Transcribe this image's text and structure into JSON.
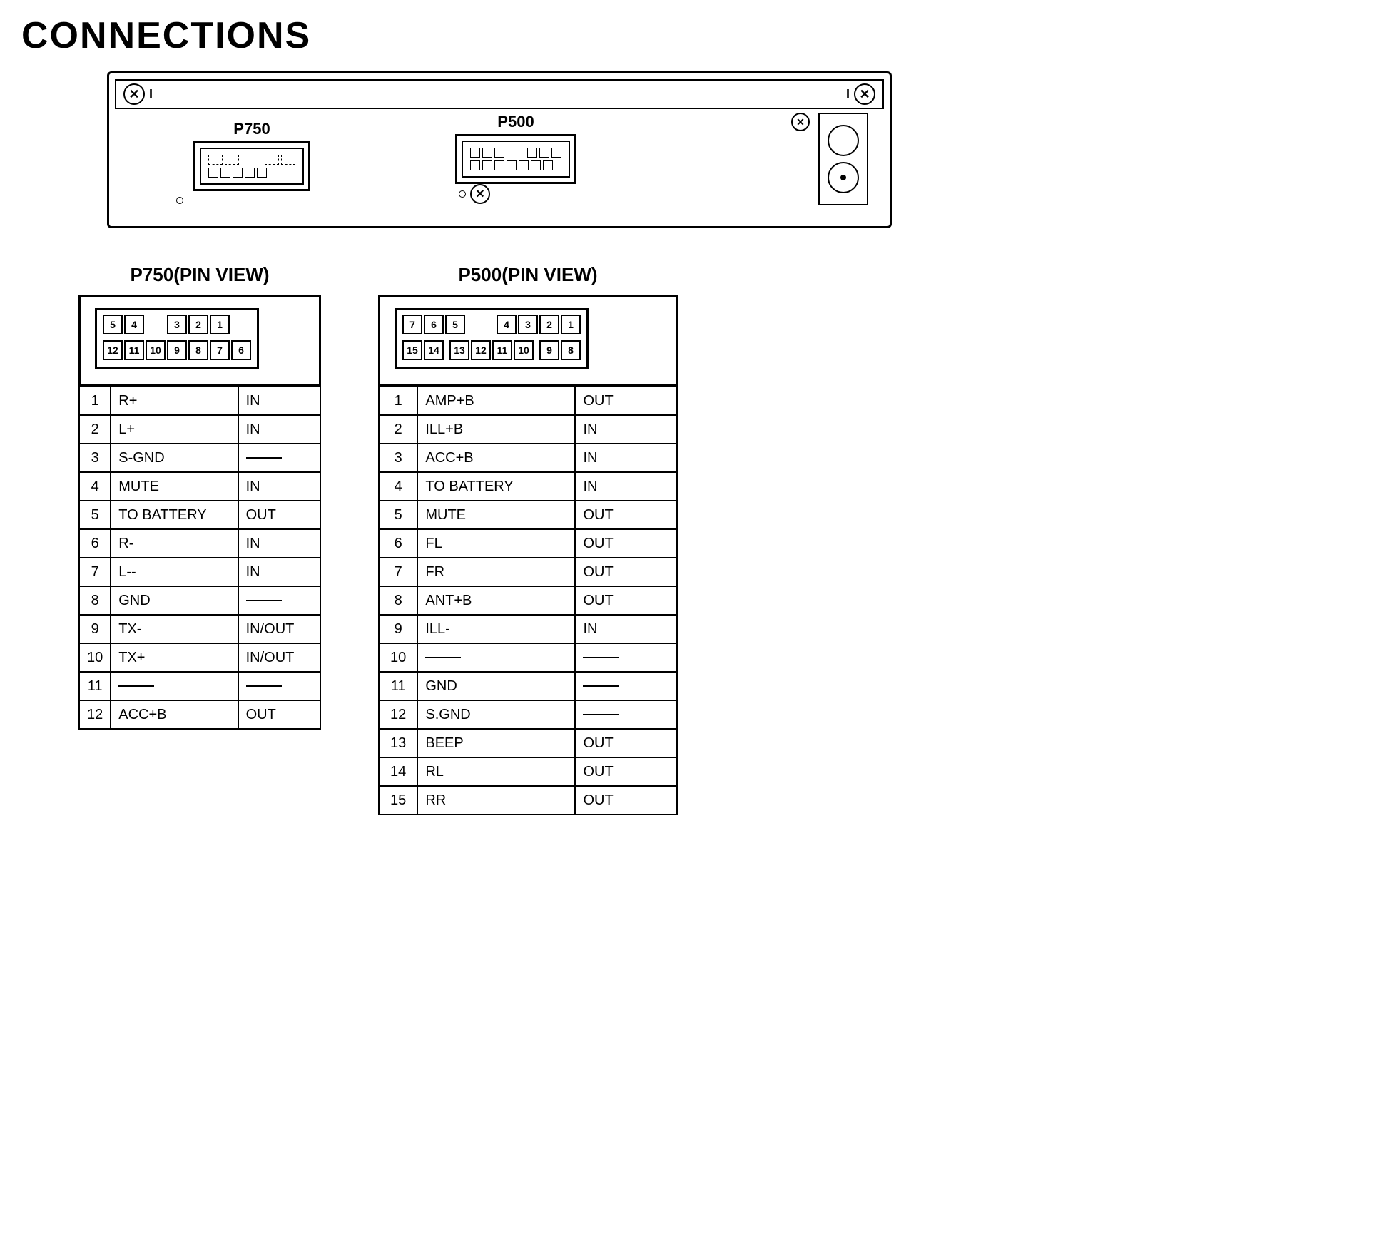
{
  "page": {
    "title": "CONNECTIONS"
  },
  "unit": {
    "p750_label": "P750",
    "p500_label": "P500"
  },
  "p750_pin_view": {
    "title": "P750(PIN VIEW)",
    "top_row": [
      "5",
      "4",
      "",
      "",
      "",
      "3",
      "2",
      "1"
    ],
    "bot_row": [
      "12",
      "11",
      "10",
      "9",
      "8",
      "7",
      "6"
    ],
    "pins": [
      {
        "num": "1",
        "name": "R+",
        "dir": "IN"
      },
      {
        "num": "2",
        "name": "L+",
        "dir": "IN"
      },
      {
        "num": "3",
        "name": "S-GND",
        "dir": "—"
      },
      {
        "num": "4",
        "name": "MUTE",
        "dir": "IN"
      },
      {
        "num": "5",
        "name": "TO BATTERY",
        "dir": "OUT"
      },
      {
        "num": "6",
        "name": "R-",
        "dir": "IN"
      },
      {
        "num": "7",
        "name": "L--",
        "dir": "IN"
      },
      {
        "num": "8",
        "name": "GND",
        "dir": "—"
      },
      {
        "num": "9",
        "name": "TX-",
        "dir": "IN/OUT"
      },
      {
        "num": "10",
        "name": "TX+",
        "dir": "IN/OUT"
      },
      {
        "num": "11",
        "name": "—",
        "dir": "—"
      },
      {
        "num": "12",
        "name": "ACC+B",
        "dir": "OUT"
      }
    ]
  },
  "p500_pin_view": {
    "title": "P500(PIN VIEW)",
    "top_row": [
      "7",
      "6",
      "5",
      "",
      "",
      "4",
      "3",
      "2",
      "1"
    ],
    "bot_row": [
      "15",
      "14",
      "",
      "13",
      "12",
      "11",
      "10",
      "",
      "9",
      "8"
    ],
    "pins": [
      {
        "num": "1",
        "name": "AMP+B",
        "dir": "OUT"
      },
      {
        "num": "2",
        "name": "ILL+B",
        "dir": "IN"
      },
      {
        "num": "3",
        "name": "ACC+B",
        "dir": "IN"
      },
      {
        "num": "4",
        "name": "TO BATTERY",
        "dir": "IN"
      },
      {
        "num": "5",
        "name": "MUTE",
        "dir": "OUT"
      },
      {
        "num": "6",
        "name": "FL",
        "dir": "OUT"
      },
      {
        "num": "7",
        "name": "FR",
        "dir": "OUT"
      },
      {
        "num": "8",
        "name": "ANT+B",
        "dir": "OUT"
      },
      {
        "num": "9",
        "name": "ILL-",
        "dir": "IN"
      },
      {
        "num": "10",
        "name": "—",
        "dir": "—"
      },
      {
        "num": "11",
        "name": "GND",
        "dir": "—"
      },
      {
        "num": "12",
        "name": "S.GND",
        "dir": "—"
      },
      {
        "num": "13",
        "name": "BEEP",
        "dir": "OUT"
      },
      {
        "num": "14",
        "name": "RL",
        "dir": "OUT"
      },
      {
        "num": "15",
        "name": "RR",
        "dir": "OUT"
      }
    ]
  }
}
